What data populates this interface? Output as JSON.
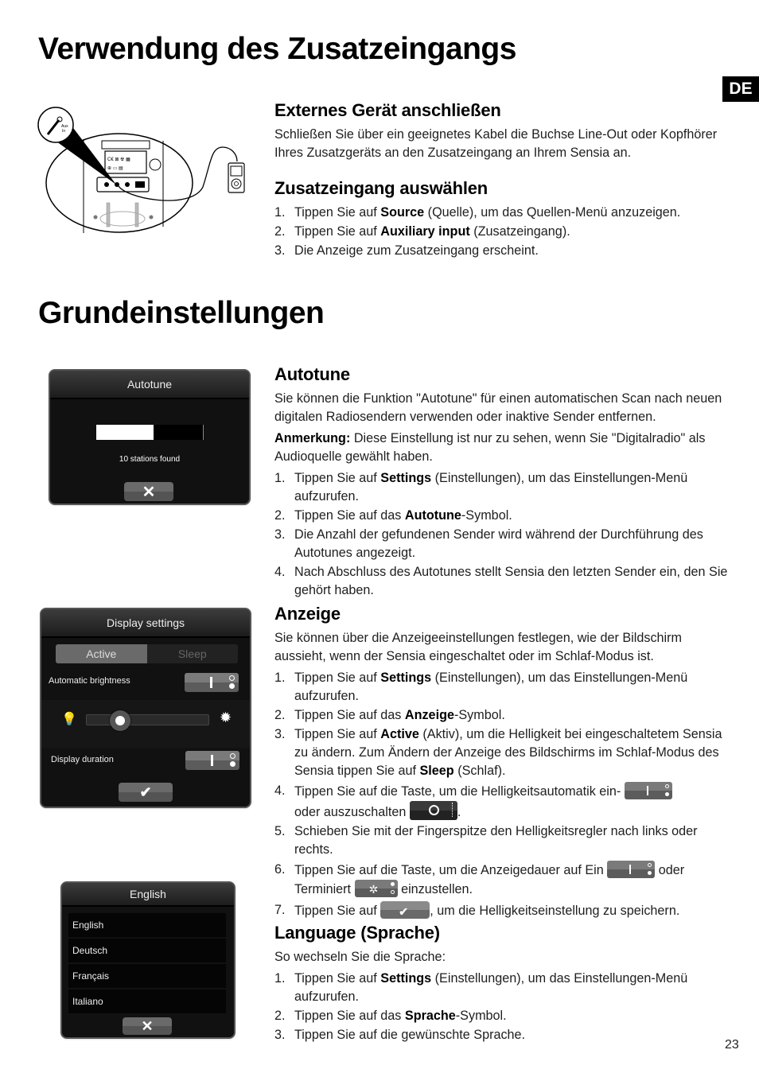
{
  "page": {
    "language_badge": "DE",
    "page_number": "23"
  },
  "section1": {
    "title": "Verwendung des Zusatzeingangs",
    "illustration": {
      "jack_label": "Aux In"
    },
    "sub1": {
      "title": "Externes Gerät anschließen",
      "text": "Schließen Sie über ein geeignetes Kabel die Buchse Line-Out oder Kopfhörer Ihres Zusatzgeräts an den Zusatzeingang an Ihrem Sensia an."
    },
    "sub2": {
      "title": "Zusatzeingang auswählen",
      "steps": [
        {
          "num": "1.",
          "pre": "Tippen Sie auf ",
          "bold": "Source",
          "post": " (Quelle), um das Quellen-Menü anzuzeigen."
        },
        {
          "num": "2.",
          "pre": "Tippen Sie auf ",
          "bold": "Auxiliary input",
          "post": " (Zusatzeingang)."
        },
        {
          "num": "3.",
          "pre": "Die Anzeige zum Zusatzeingang erscheint.",
          "bold": "",
          "post": ""
        }
      ]
    }
  },
  "section2": {
    "title": "Grundeinstellungen",
    "autotune": {
      "title": "Autotune",
      "intro": "Sie können die Funktion \"Autotune\" für einen automatischen Scan nach neuen digitalen Radiosendern verwenden oder inaktive Sender entfernen.",
      "note_label": "Anmerkung:",
      "note_text": " Diese Einstellung ist nur zu sehen, wenn Sie \"Digitalradio\" als Audioquelle gewählt haben.",
      "steps": [
        {
          "num": "1.",
          "pre": "Tippen Sie auf ",
          "bold": "Settings",
          "post": " (Einstellungen), um das Einstellungen-Menü aufzurufen."
        },
        {
          "num": "2.",
          "pre": "Tippen Sie auf das ",
          "bold": "Autotune",
          "post": "-Symbol."
        },
        {
          "num": "3.",
          "pre": "Die Anzahl der gefundenen Sender wird während der Durchführung des Autotunes angezeigt.",
          "bold": "",
          "post": ""
        },
        {
          "num": "4.",
          "pre": "Nach Abschluss des Autotunes stellt Sensia den letzten Sender ein, den Sie gehört haben.",
          "bold": "",
          "post": ""
        }
      ],
      "screen": {
        "title": "Autotune",
        "progress": 0.54,
        "status": "10 stations found",
        "close_icon": "close-icon"
      }
    },
    "anzeige": {
      "title": "Anzeige",
      "intro": "Sie können über die Anzeigeeinstellungen festlegen, wie der Bildschirm aussieht, wenn der Sensia eingeschaltet oder im Schlaf-Modus ist.",
      "steps": [
        {
          "num": "1.",
          "pre": "Tippen Sie auf ",
          "bold": "Settings",
          "post": " (Einstellungen), um das Einstellungen-Menü aufzurufen."
        },
        {
          "num": "2.",
          "pre": "Tippen Sie auf das ",
          "bold": "Anzeige",
          "post": "-Symbol."
        },
        {
          "num": "3.",
          "pre": "Tippen Sie auf ",
          "bold": "Active",
          "post": " (Aktiv), um die Helligkeit bei eingeschaltetem Sensia zu ändern. Zum Ändern der Anzeige des Bildschirms im Schlaf-Modus des Sensia tippen Sie auf ",
          "bold2": "Sleep",
          "post2": " (Schlaf)."
        }
      ],
      "step4": {
        "num": "4.",
        "a": "Tippen Sie auf die Taste, um die Helligkeitsautomatik ein-",
        "b": "oder auszuschalten",
        "c": "."
      },
      "step5": {
        "num": "5.",
        "text": "Schieben Sie mit der Fingerspitze den Helligkeitsregler nach links oder rechts."
      },
      "step6": {
        "num": "6.",
        "a": "Tippen Sie auf die Taste, um die Anzeigedauer auf Ein",
        "b": "oder",
        "c": "Terminiert",
        "d": "einzustellen."
      },
      "step7": {
        "num": "7.",
        "a": "Tippen Sie auf",
        "b": ", um die Helligkeitseinstellung zu speichern."
      },
      "screen": {
        "title": "Display settings",
        "tabs": [
          {
            "label": "Active",
            "active": true
          },
          {
            "label": "Sleep",
            "active": false
          }
        ],
        "auto_brightness_label": "Automatic brightness",
        "auto_brightness_state": "on",
        "brightness_level": 0.2,
        "display_duration_label": "Display duration",
        "display_duration_state": "on",
        "confirm_icon": "check-icon"
      }
    },
    "language": {
      "title": "Language (Sprache)",
      "intro": "So wechseln Sie die Sprache:",
      "steps": [
        {
          "num": "1.",
          "pre": "Tippen Sie auf ",
          "bold": "Settings",
          "post": " (Einstellungen), um das Einstellungen-Menü aufzurufen."
        },
        {
          "num": "2.",
          "pre": "Tippen Sie auf das ",
          "bold": "Sprache",
          "post": "-Symbol."
        },
        {
          "num": "3.",
          "pre": "Tippen Sie auf die gewünschte Sprache.",
          "bold": "",
          "post": ""
        }
      ],
      "screen": {
        "title": "English",
        "options": [
          "English",
          "Deutsch",
          "Français",
          "Italiano"
        ],
        "close_icon": "close-icon"
      }
    }
  }
}
